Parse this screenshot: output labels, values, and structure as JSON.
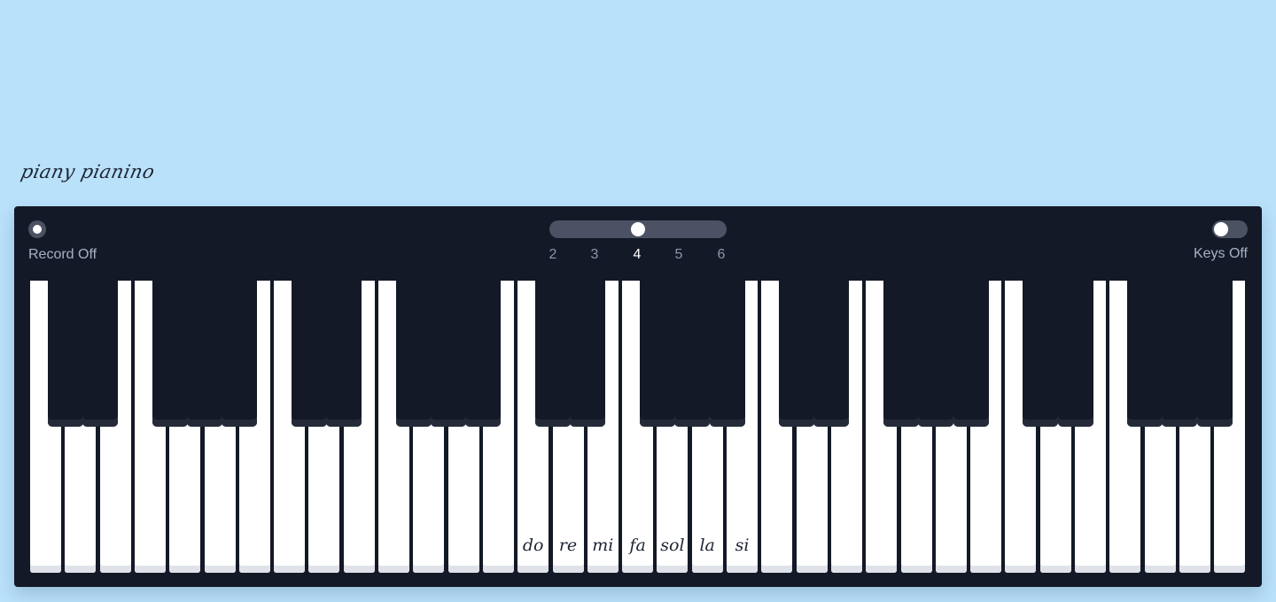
{
  "app": {
    "logo": "piany pianino"
  },
  "controls": {
    "record": {
      "label": "Record Off",
      "on": false
    },
    "octave": {
      "options": [
        "2",
        "3",
        "4",
        "5",
        "6"
      ],
      "selected": "4"
    },
    "keys": {
      "label": "Keys Off",
      "on": false
    }
  },
  "keyboard": {
    "white_key_count": 35,
    "black_key_count": 25,
    "solfege": [
      "do",
      "re",
      "mi",
      "fa",
      "sol",
      "la",
      "si"
    ]
  },
  "colors": {
    "background": "#b9e1fa",
    "panel": "#141927",
    "white_key": "#ffffff",
    "black_key": "#141927",
    "toggle": "#4b5262",
    "text_muted": "#a8b1c4",
    "text_active": "#ffffff"
  }
}
